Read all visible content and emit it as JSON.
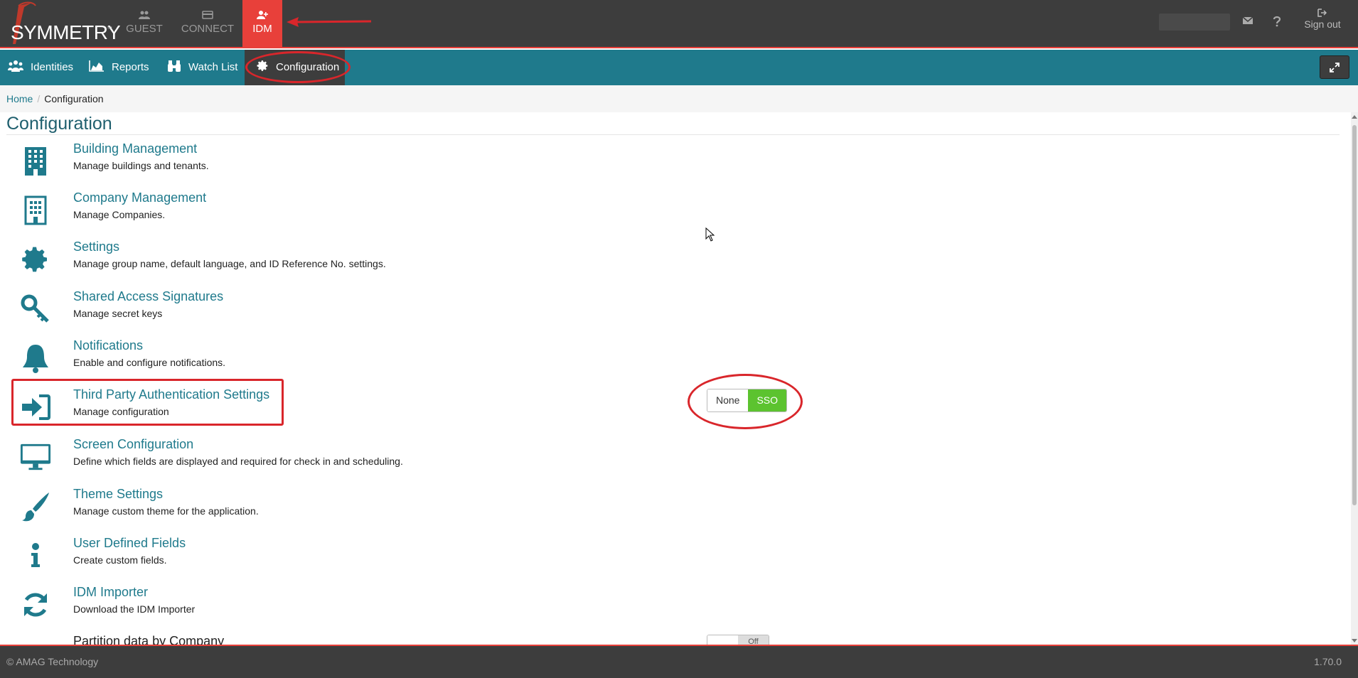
{
  "app": {
    "logo_text": "SYMMETRY",
    "logo_tm": "™"
  },
  "top_nav": {
    "items": [
      {
        "label": "GUEST",
        "icon": "users-icon"
      },
      {
        "label": "CONNECT",
        "icon": "card-icon"
      },
      {
        "label": "IDM",
        "icon": "user-plus-icon",
        "active": true
      }
    ],
    "sign_out": "Sign out"
  },
  "sub_nav": {
    "items": [
      {
        "label": "Identities",
        "icon": "users-icon"
      },
      {
        "label": "Reports",
        "icon": "area-chart-icon"
      },
      {
        "label": "Watch List",
        "icon": "binoculars-icon"
      },
      {
        "label": "Configuration",
        "icon": "gear-icon",
        "active": true
      }
    ]
  },
  "breadcrumb": {
    "home": "Home",
    "separator": "/",
    "current": "Configuration"
  },
  "page_title": "Configuration",
  "items": [
    {
      "name": "Building Management",
      "desc": "Manage buildings and tenants.",
      "icon": "building-icon"
    },
    {
      "name": "Company Management",
      "desc": "Manage Companies.",
      "icon": "office-building-icon"
    },
    {
      "name": "Settings",
      "desc": "Manage group name, default language, and ID Reference No. settings.",
      "icon": "gear-icon"
    },
    {
      "name": "Shared Access Signatures",
      "desc": "Manage secret keys",
      "icon": "key-icon"
    },
    {
      "name": "Notifications",
      "desc": "Enable and configure notifications.",
      "icon": "bell-icon"
    },
    {
      "name": "Third Party Authentication Settings",
      "desc": "Manage configuration",
      "icon": "sign-in-icon"
    },
    {
      "name": "Screen Configuration",
      "desc": "Define which fields are displayed and required for check in and scheduling.",
      "icon": "monitor-icon"
    },
    {
      "name": "Theme Settings",
      "desc": "Manage custom theme for the application.",
      "icon": "paintbrush-icon"
    },
    {
      "name": "User Defined Fields",
      "desc": "Create custom fields.",
      "icon": "info-icon"
    },
    {
      "name": "IDM Importer",
      "desc": "Download the IDM Importer",
      "icon": "refresh-icon"
    },
    {
      "name": "Partition data by Company",
      "desc": "",
      "icon": "circle-icon"
    }
  ],
  "auth_toggle": {
    "options": [
      "None",
      "SSO"
    ],
    "selected": "SSO"
  },
  "partition_toggle": {
    "options": [
      "",
      "Off"
    ],
    "selected": "Off"
  },
  "footer": {
    "copyright": "© AMAG Technology",
    "version": "1.70.0"
  },
  "colors": {
    "accent": "#1f7a8c",
    "topbar": "#3d3d3d",
    "active_app": "#e8403a",
    "toggle_on": "#5cc32f",
    "annotation": "#d9262b"
  }
}
